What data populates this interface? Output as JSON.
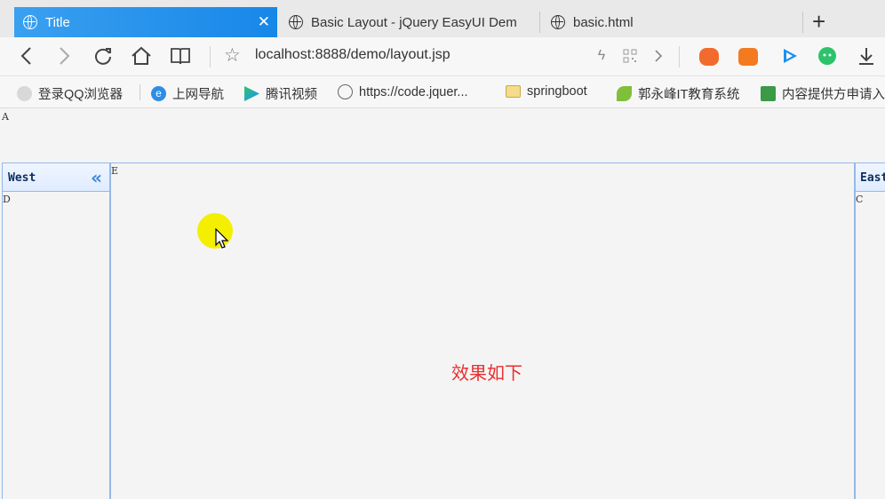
{
  "browser": {
    "tabs": [
      {
        "label": "Title",
        "active": true
      },
      {
        "label": "Basic Layout - jQuery EasyUI Dem",
        "active": false
      },
      {
        "label": "basic.html",
        "active": false
      }
    ],
    "close_glyph": "✕",
    "new_tab_glyph": "+",
    "address": "localhost:8888/demo/layout.jsp",
    "bookmarks": [
      "登录QQ浏览器",
      "上网导航",
      "腾讯视频",
      "https://code.jquer...",
      "springboot",
      "郭永峰IT教育系统",
      "内容提供方申请入"
    ],
    "accent": "#1787e8"
  },
  "page": {
    "north_letter": "A",
    "west_title": "West",
    "west_collapse": "«",
    "west_letter": "D",
    "center_letter": "E",
    "east_title": "East",
    "east_letter": "C",
    "center_caption": "效果如下",
    "caption_color": "#e8302f",
    "border_color": "#95b8e7"
  }
}
